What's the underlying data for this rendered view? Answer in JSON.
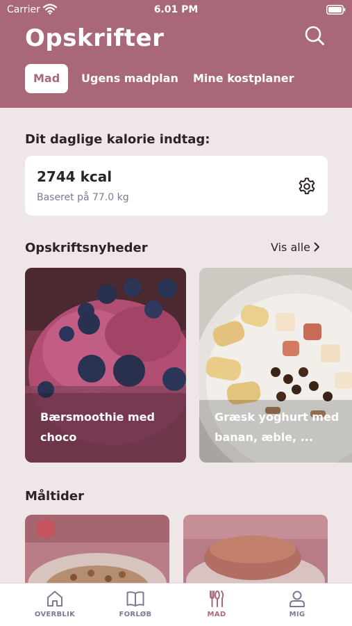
{
  "status_bar": {
    "carrier": "Carrier",
    "time": "6.01 PM"
  },
  "header": {
    "title": "Opskrifter",
    "tabs": [
      {
        "label": "Mad",
        "active": true
      },
      {
        "label": "Ugens madplan",
        "active": false
      },
      {
        "label": "Mine kostplaner",
        "active": false
      }
    ]
  },
  "calories": {
    "heading": "Dit daglige kalorie indtag:",
    "value": "2744 kcal",
    "basis": "Baseret på 77.0 kg"
  },
  "news": {
    "heading": "Opskriftsnyheder",
    "see_all": "Vis alle",
    "items": [
      {
        "title": "Bærsmoothie med choco"
      },
      {
        "title": "Græsk yoghurt med banan, æble, ..."
      }
    ]
  },
  "meals": {
    "heading": "Måltider"
  },
  "tabbar": {
    "items": [
      {
        "label": "OVERBLIK",
        "icon": "home-icon",
        "active": false
      },
      {
        "label": "FORLØB",
        "icon": "book-icon",
        "active": false
      },
      {
        "label": "MAD",
        "icon": "utensils-icon",
        "active": true
      },
      {
        "label": "MIG",
        "icon": "person-icon",
        "active": false
      }
    ]
  },
  "colors": {
    "brand": "#a86878",
    "background": "#efe6e8",
    "muted_text": "#7b7a92"
  }
}
